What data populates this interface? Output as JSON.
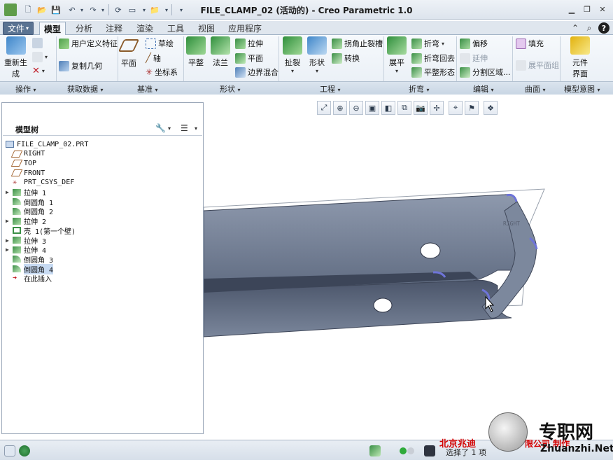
{
  "window": {
    "title": "FILE_CLAMP_02 (活动的) - Creo Parametric 1.0"
  },
  "tabs": [
    {
      "label": "文件",
      "dropdown": "▾"
    },
    {
      "label": "模型"
    },
    {
      "label": "分析"
    },
    {
      "label": "注释"
    },
    {
      "label": "渲染"
    },
    {
      "label": "工具"
    },
    {
      "label": "视图"
    },
    {
      "label": "应用程序"
    }
  ],
  "ribbon": {
    "operations": {
      "regen_line1": "重新生",
      "regen_line2": "成",
      "group": "操作"
    },
    "get_data": {
      "udf": "用户定义特征",
      "copy_geom": "复制几何",
      "group": "获取数据"
    },
    "datum": {
      "plane": "平面",
      "sketch": "草绘",
      "axis": "轴",
      "csys": "坐标系",
      "group": "基准"
    },
    "shapes": {
      "flat": "平整",
      "flange": "法兰",
      "extrude": "拉伸",
      "plane": "平面",
      "blend": "边界混合",
      "group": "形状"
    },
    "engineering": {
      "rip": "扯裂",
      "form": "形状",
      "corner_relief": "拐角止裂槽",
      "convert": "转换",
      "group": "工程"
    },
    "bends": {
      "unbend": "展平",
      "bend": "折弯",
      "bend_back": "折弯回去",
      "flat_pattern": "平整形态",
      "group": "折弯"
    },
    "editing": {
      "offset": "偏移",
      "extend": "延伸",
      "split": "分割区域...",
      "group": "编辑"
    },
    "surfaces": {
      "fill": "填充",
      "flatten_quilt": "展平面组",
      "group": "曲面"
    },
    "intent": {
      "component_line1": "元件",
      "component_line2": "界面",
      "group": "模型意图"
    }
  },
  "model_tree": {
    "title": "模型树",
    "items": [
      {
        "label": "FILE_CLAMP_02.PRT",
        "icon": "part-icon",
        "expandable": false,
        "indent": 0
      },
      {
        "label": "RIGHT",
        "icon": "datum-plane-icon",
        "expandable": false,
        "indent": 1
      },
      {
        "label": "TOP",
        "icon": "datum-plane-icon",
        "expandable": false,
        "indent": 1
      },
      {
        "label": "FRONT",
        "icon": "datum-plane-icon",
        "expandable": false,
        "indent": 1
      },
      {
        "label": "PRT_CSYS_DEF",
        "icon": "csys-icon",
        "expandable": false,
        "indent": 1
      },
      {
        "label": "拉伸 1",
        "icon": "extrude-icon",
        "expandable": true,
        "indent": 1
      },
      {
        "label": "倒圆角 1",
        "icon": "round-icon",
        "expandable": false,
        "indent": 1
      },
      {
        "label": "倒圆角 2",
        "icon": "round-icon",
        "expandable": false,
        "indent": 1
      },
      {
        "label": "拉伸 2",
        "icon": "extrude-icon",
        "expandable": true,
        "indent": 1
      },
      {
        "label": "壳 1(第一个壁)",
        "icon": "shell-icon",
        "expandable": false,
        "indent": 1
      },
      {
        "label": "拉伸 3",
        "icon": "extrude-icon",
        "expandable": true,
        "indent": 1
      },
      {
        "label": "拉伸 4",
        "icon": "extrude-icon",
        "expandable": true,
        "indent": 1
      },
      {
        "label": "倒圆角 3",
        "icon": "round-icon",
        "expandable": false,
        "indent": 1
      },
      {
        "label": "倒圆角 4",
        "icon": "round-icon",
        "expandable": false,
        "indent": 1,
        "selected": true
      },
      {
        "label": "在此插入",
        "icon": "insert-here-icon",
        "expandable": false,
        "indent": 1
      }
    ]
  },
  "viewport": {
    "label": "RIGHT"
  },
  "status": {
    "selection_text": "选择了 1 项"
  },
  "watermark": {
    "brand": "专职网",
    "url": "Zhuanzhi.Net",
    "left_text": "北京兆迪",
    "right_text": "限公司 制作"
  },
  "colors": {
    "accent": "#5a7392",
    "selection": "#c7daf2",
    "model_body": "#6f7c92",
    "watermark_red": "#d40000"
  }
}
